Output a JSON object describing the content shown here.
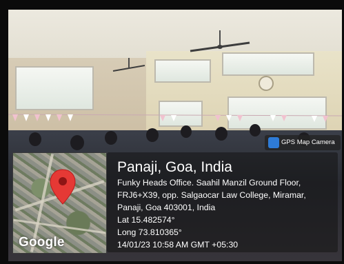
{
  "overlay": {
    "title": "Panaji, Goa, India",
    "address_lines": [
      "Funky Heads Office. Saahil Manzil Ground Floor,",
      "FRJ6+X39, opp. Salgaocar Law College, Miramar,",
      "Panaji, Goa 403001, India"
    ],
    "latitude": "Lat 15.482574°",
    "longitude": "Long 73.810365°",
    "timestamp": "14/01/23 10:58 AM GMT +05:30",
    "map_brand": "Google",
    "app_badge": "GPS Map Camera",
    "pin_color": "#e53935",
    "app_icon": "map-camera-icon"
  }
}
